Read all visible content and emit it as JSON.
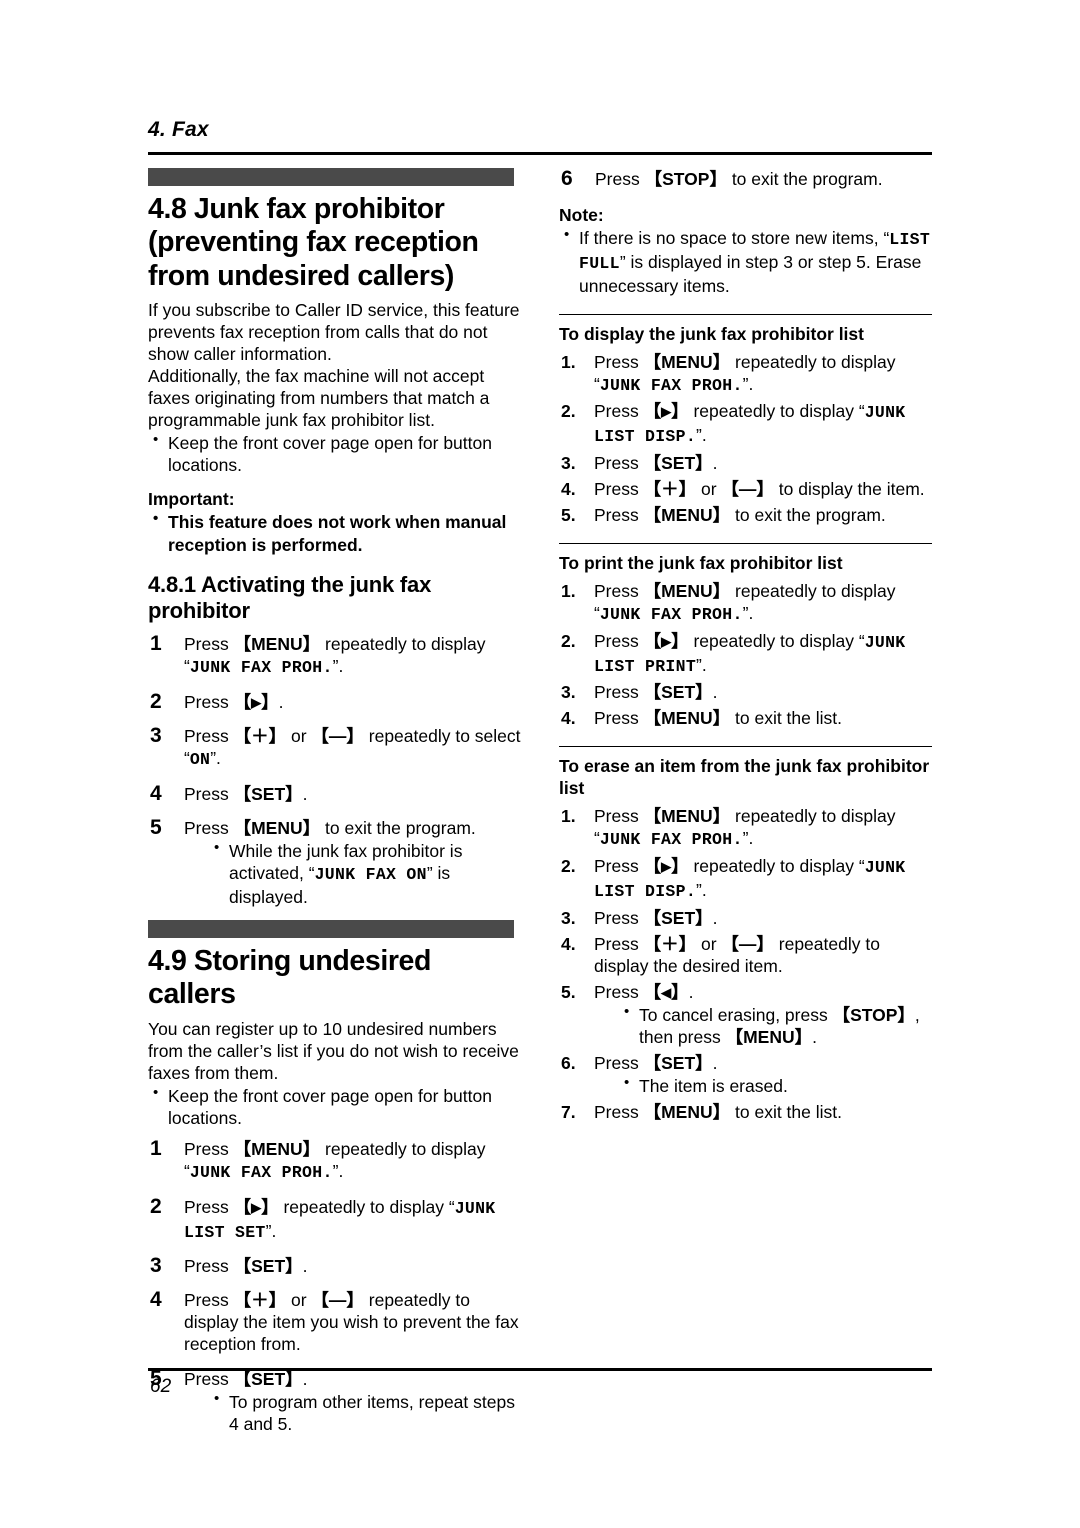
{
  "page": {
    "running_head": "4. Fax",
    "page_number": "62",
    "accent_bar_color": "#4a4a4a"
  },
  "left_column": {
    "section_48": {
      "heading": "4.8 Junk fax prohibitor (preventing fax reception from undesired callers)",
      "intro_paragraph_1": "If you subscribe to Caller ID service, this feature prevents fax reception from calls that do not show caller information.",
      "intro_paragraph_2": "Additionally, the fax machine will not accept faxes originating from numbers that match a programmable junk fax prohibitor list.",
      "bullets": [
        "Keep the front cover page open for button locations."
      ],
      "important_label": "Important:",
      "important_bullets": [
        "This feature does not work when manual reception is performed."
      ],
      "subsection": {
        "heading": "4.8.1 Activating the junk fax prohibitor",
        "steps": [
          {
            "parts": [
              {
                "t": "text",
                "v": "Press "
              },
              {
                "t": "key",
                "v": "MENU"
              },
              {
                "t": "text",
                "v": " repeatedly to display “"
              },
              {
                "t": "lcd",
                "v": "JUNK FAX PROH."
              },
              {
                "t": "text",
                "v": "”."
              }
            ]
          },
          {
            "parts": [
              {
                "t": "text",
                "v": "Press "
              },
              {
                "t": "key-arrow",
                "v": "▶"
              },
              {
                "t": "text",
                "v": "."
              }
            ]
          },
          {
            "parts": [
              {
                "t": "text",
                "v": "Press "
              },
              {
                "t": "key-sym",
                "v": "＋"
              },
              {
                "t": "text",
                "v": " or "
              },
              {
                "t": "key-sym",
                "v": "—"
              },
              {
                "t": "text",
                "v": " repeatedly to select “"
              },
              {
                "t": "lcd",
                "v": "ON"
              },
              {
                "t": "text",
                "v": "”."
              }
            ]
          },
          {
            "parts": [
              {
                "t": "text",
                "v": "Press "
              },
              {
                "t": "key",
                "v": "SET"
              },
              {
                "t": "text",
                "v": "."
              }
            ]
          },
          {
            "parts": [
              {
                "t": "text",
                "v": "Press "
              },
              {
                "t": "key",
                "v": "MENU"
              },
              {
                "t": "text",
                "v": " to exit the program."
              }
            ],
            "bullets": [
              {
                "parts": [
                  {
                    "t": "text",
                    "v": "While the junk fax prohibitor is activated, “"
                  },
                  {
                    "t": "lcd",
                    "v": "JUNK FAX ON"
                  },
                  {
                    "t": "text",
                    "v": "” is displayed."
                  }
                ]
              }
            ]
          }
        ]
      }
    },
    "section_49": {
      "heading": "4.9 Storing undesired callers",
      "intro_paragraph_1": "You can register up to 10 undesired numbers from the caller’s list if you do not wish to receive faxes from them.",
      "bullets": [
        "Keep the front cover page open for button locations."
      ],
      "steps": [
        {
          "parts": [
            {
              "t": "text",
              "v": "Press "
            },
            {
              "t": "key",
              "v": "MENU"
            },
            {
              "t": "text",
              "v": " repeatedly to display “"
            },
            {
              "t": "lcd",
              "v": "JUNK FAX PROH."
            },
            {
              "t": "text",
              "v": "”."
            }
          ]
        },
        {
          "parts": [
            {
              "t": "text",
              "v": "Press "
            },
            {
              "t": "key-arrow",
              "v": "▶"
            },
            {
              "t": "text",
              "v": " repeatedly to display “"
            },
            {
              "t": "lcd",
              "v": "JUNK LIST SET"
            },
            {
              "t": "text",
              "v": "”."
            }
          ]
        },
        {
          "parts": [
            {
              "t": "text",
              "v": "Press "
            },
            {
              "t": "key",
              "v": "SET"
            },
            {
              "t": "text",
              "v": "."
            }
          ]
        },
        {
          "parts": [
            {
              "t": "text",
              "v": "Press "
            },
            {
              "t": "key-sym",
              "v": "＋"
            },
            {
              "t": "text",
              "v": " or "
            },
            {
              "t": "key-sym",
              "v": "—"
            },
            {
              "t": "text",
              "v": " repeatedly to display the item you wish to prevent the fax reception from."
            }
          ]
        },
        {
          "parts": [
            {
              "t": "text",
              "v": "Press "
            },
            {
              "t": "key",
              "v": "SET"
            },
            {
              "t": "text",
              "v": "."
            }
          ],
          "bullets": [
            {
              "parts": [
                {
                  "t": "text",
                  "v": "To program other items, repeat steps 4 and 5."
                }
              ]
            }
          ]
        }
      ]
    }
  },
  "right_column": {
    "step6": {
      "number": "6",
      "parts": [
        {
          "t": "text",
          "v": "Press "
        },
        {
          "t": "key",
          "v": "STOP"
        },
        {
          "t": "text",
          "v": " to exit the program."
        }
      ]
    },
    "note": {
      "label": "Note:",
      "bullets": [
        {
          "parts": [
            {
              "t": "text",
              "v": "If there is no space to store new items, “"
            },
            {
              "t": "lcd",
              "v": "LIST FULL"
            },
            {
              "t": "text",
              "v": "” is displayed in step 3 or step 5. Erase unnecessary items."
            }
          ]
        }
      ]
    },
    "tasks": [
      {
        "heading": "To display the junk fax prohibitor list",
        "steps": [
          {
            "parts": [
              {
                "t": "text",
                "v": "Press "
              },
              {
                "t": "key",
                "v": "MENU"
              },
              {
                "t": "text",
                "v": " repeatedly to display “"
              },
              {
                "t": "lcd",
                "v": "JUNK FAX PROH."
              },
              {
                "t": "text",
                "v": "”."
              }
            ]
          },
          {
            "parts": [
              {
                "t": "text",
                "v": "Press "
              },
              {
                "t": "key-arrow",
                "v": "▶"
              },
              {
                "t": "text",
                "v": " repeatedly to display “"
              },
              {
                "t": "lcd",
                "v": "JUNK LIST DISP."
              },
              {
                "t": "text",
                "v": "”."
              }
            ]
          },
          {
            "parts": [
              {
                "t": "text",
                "v": "Press "
              },
              {
                "t": "key",
                "v": "SET"
              },
              {
                "t": "text",
                "v": "."
              }
            ]
          },
          {
            "parts": [
              {
                "t": "text",
                "v": "Press "
              },
              {
                "t": "key-sym",
                "v": "＋"
              },
              {
                "t": "text",
                "v": " or "
              },
              {
                "t": "key-sym",
                "v": "—"
              },
              {
                "t": "text",
                "v": " to display the item."
              }
            ]
          },
          {
            "parts": [
              {
                "t": "text",
                "v": "Press "
              },
              {
                "t": "key",
                "v": "MENU"
              },
              {
                "t": "text",
                "v": " to exit the program."
              }
            ]
          }
        ]
      },
      {
        "heading": "To print the junk fax prohibitor list",
        "steps": [
          {
            "parts": [
              {
                "t": "text",
                "v": "Press "
              },
              {
                "t": "key",
                "v": "MENU"
              },
              {
                "t": "text",
                "v": " repeatedly to display “"
              },
              {
                "t": "lcd",
                "v": "JUNK FAX PROH."
              },
              {
                "t": "text",
                "v": "”."
              }
            ]
          },
          {
            "parts": [
              {
                "t": "text",
                "v": "Press "
              },
              {
                "t": "key-arrow",
                "v": "▶"
              },
              {
                "t": "text",
                "v": " repeatedly to display “"
              },
              {
                "t": "lcd",
                "v": "JUNK LIST PRINT"
              },
              {
                "t": "text",
                "v": "”."
              }
            ]
          },
          {
            "parts": [
              {
                "t": "text",
                "v": "Press "
              },
              {
                "t": "key",
                "v": "SET"
              },
              {
                "t": "text",
                "v": "."
              }
            ]
          },
          {
            "parts": [
              {
                "t": "text",
                "v": "Press "
              },
              {
                "t": "key",
                "v": "MENU"
              },
              {
                "t": "text",
                "v": " to exit the list."
              }
            ]
          }
        ]
      },
      {
        "heading": "To erase an item from the junk fax prohibitor list",
        "steps": [
          {
            "parts": [
              {
                "t": "text",
                "v": "Press "
              },
              {
                "t": "key",
                "v": "MENU"
              },
              {
                "t": "text",
                "v": " repeatedly to display “"
              },
              {
                "t": "lcd",
                "v": "JUNK FAX PROH."
              },
              {
                "t": "text",
                "v": "”."
              }
            ]
          },
          {
            "parts": [
              {
                "t": "text",
                "v": "Press "
              },
              {
                "t": "key-arrow",
                "v": "▶"
              },
              {
                "t": "text",
                "v": " repeatedly to display “"
              },
              {
                "t": "lcd",
                "v": "JUNK LIST DISP."
              },
              {
                "t": "text",
                "v": "”."
              }
            ]
          },
          {
            "parts": [
              {
                "t": "text",
                "v": "Press "
              },
              {
                "t": "key",
                "v": "SET"
              },
              {
                "t": "text",
                "v": "."
              }
            ]
          },
          {
            "parts": [
              {
                "t": "text",
                "v": "Press "
              },
              {
                "t": "key-sym",
                "v": "＋"
              },
              {
                "t": "text",
                "v": " or "
              },
              {
                "t": "key-sym",
                "v": "—"
              },
              {
                "t": "text",
                "v": " repeatedly to display the desired item."
              }
            ]
          },
          {
            "parts": [
              {
                "t": "text",
                "v": "Press "
              },
              {
                "t": "key-arrow",
                "v": "◀"
              },
              {
                "t": "text",
                "v": "."
              }
            ],
            "bullets": [
              {
                "parts": [
                  {
                    "t": "text",
                    "v": "To cancel erasing, press "
                  },
                  {
                    "t": "key",
                    "v": "STOP"
                  },
                  {
                    "t": "text",
                    "v": ", then press "
                  },
                  {
                    "t": "key",
                    "v": "MENU"
                  },
                  {
                    "t": "text",
                    "v": "."
                  }
                ]
              }
            ]
          },
          {
            "parts": [
              {
                "t": "text",
                "v": "Press "
              },
              {
                "t": "key",
                "v": "SET"
              },
              {
                "t": "text",
                "v": "."
              }
            ],
            "bullets": [
              {
                "parts": [
                  {
                    "t": "text",
                    "v": "The item is erased."
                  }
                ]
              }
            ]
          },
          {
            "parts": [
              {
                "t": "text",
                "v": "Press "
              },
              {
                "t": "key",
                "v": "MENU"
              },
              {
                "t": "text",
                "v": " to exit the list."
              }
            ]
          }
        ]
      }
    ]
  }
}
